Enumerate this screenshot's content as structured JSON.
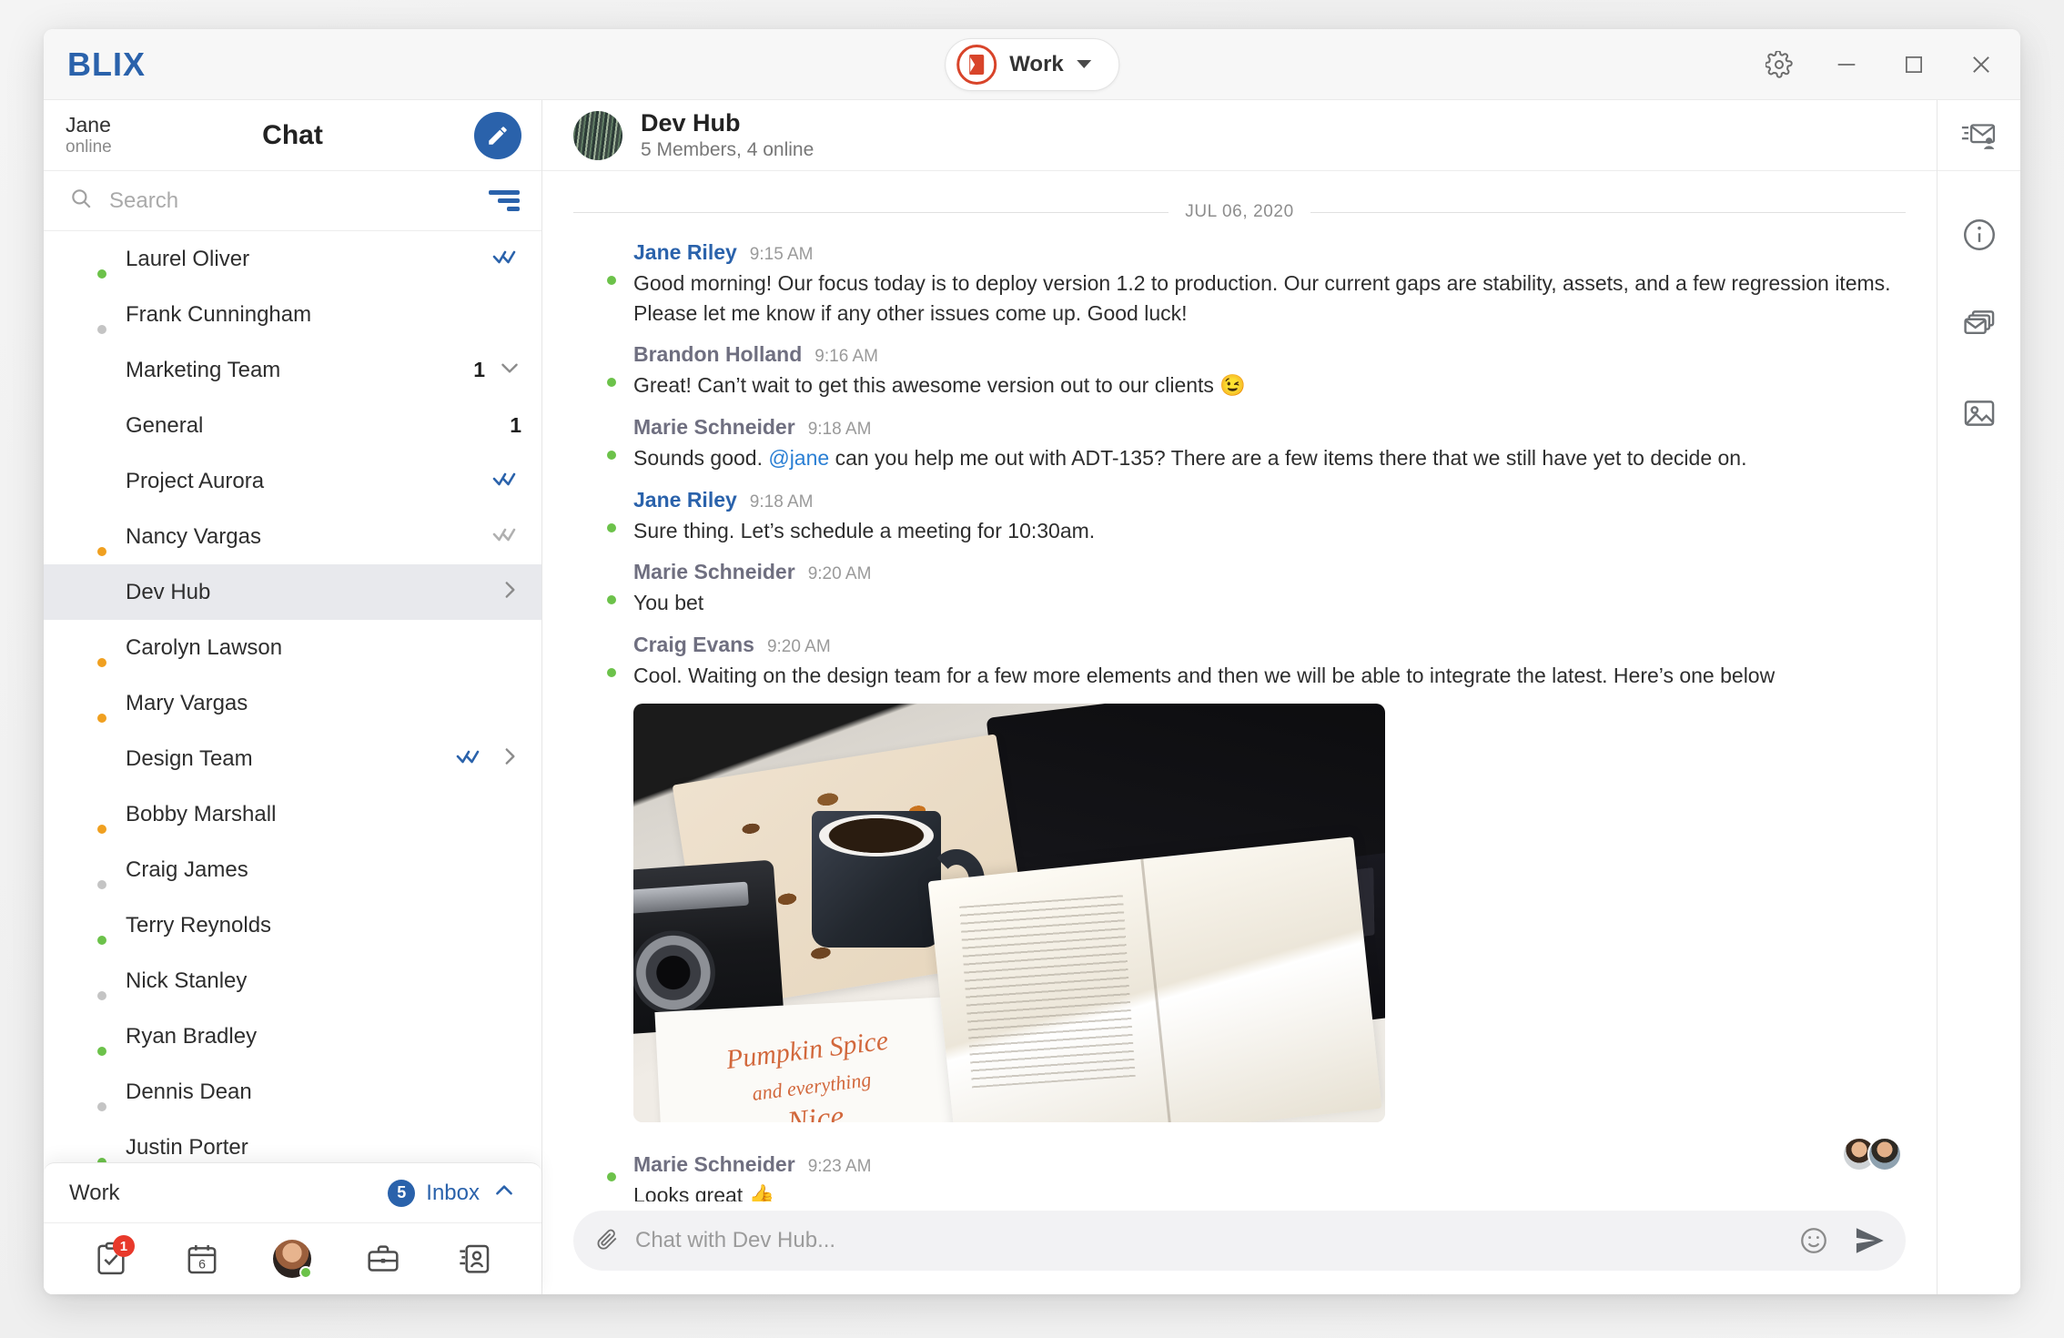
{
  "app": {
    "brand": "BLIX",
    "workspace_label": "Work",
    "office_icon": "office-icon"
  },
  "titlebar": {
    "settings_icon": "gear-icon",
    "minimize_icon": "minimize-icon",
    "maximize_icon": "maximize-icon",
    "close_icon": "close-icon"
  },
  "sidebar": {
    "user_name": "Jane",
    "user_status": "online",
    "title": "Chat",
    "compose_icon": "pencil-icon",
    "search_placeholder": "Search",
    "search_value": "",
    "search_icon": "search-icon",
    "filter_icon": "filter-icon",
    "items": [
      {
        "name": "Laurel Oliver",
        "type": "person",
        "presence": "online",
        "check": "blue",
        "badge": "",
        "chevron": ""
      },
      {
        "name": "Frank Cunningham",
        "type": "person",
        "presence": "offline",
        "check": "",
        "badge": "",
        "chevron": ""
      },
      {
        "name": "Marketing Team",
        "type": "group",
        "presence": "",
        "check": "",
        "badge": "1",
        "chevron": "down"
      },
      {
        "name": "General",
        "type": "sub",
        "presence": "",
        "check": "",
        "badge": "1",
        "chevron": ""
      },
      {
        "name": "Project Aurora",
        "type": "sub",
        "presence": "",
        "check": "blue",
        "badge": "",
        "chevron": ""
      },
      {
        "name": "Nancy Vargas",
        "type": "person",
        "presence": "away",
        "check": "gray",
        "badge": "",
        "chevron": ""
      },
      {
        "name": "Dev Hub",
        "type": "group",
        "presence": "",
        "check": "",
        "badge": "",
        "chevron": "right",
        "active": true
      },
      {
        "name": "Carolyn Lawson",
        "type": "person",
        "presence": "away",
        "check": "",
        "badge": "",
        "chevron": ""
      },
      {
        "name": "Mary Vargas",
        "type": "person",
        "presence": "away",
        "check": "",
        "badge": "",
        "chevron": ""
      },
      {
        "name": "Design Team",
        "type": "group",
        "presence": "",
        "check": "blue",
        "badge": "",
        "chevron": "right"
      },
      {
        "name": "Bobby Marshall",
        "type": "person",
        "presence": "away",
        "check": "",
        "badge": "",
        "chevron": ""
      },
      {
        "name": "Craig James",
        "type": "person",
        "presence": "offline",
        "check": "",
        "badge": "",
        "chevron": ""
      },
      {
        "name": "Terry Reynolds",
        "type": "person",
        "presence": "online",
        "check": "",
        "badge": "",
        "chevron": ""
      },
      {
        "name": "Nick Stanley",
        "type": "person",
        "presence": "offline",
        "check": "",
        "badge": "",
        "chevron": ""
      },
      {
        "name": "Ryan Bradley",
        "type": "person",
        "presence": "online",
        "check": "",
        "badge": "",
        "chevron": ""
      },
      {
        "name": "Dennis Dean",
        "type": "person",
        "presence": "offline",
        "check": "",
        "badge": "",
        "chevron": ""
      },
      {
        "name": "Justin Porter",
        "type": "person",
        "presence": "online",
        "check": "",
        "badge": "",
        "chevron": ""
      }
    ],
    "bottom": {
      "account_label": "Work",
      "inbox_count": "5",
      "inbox_label": "Inbox",
      "collapse_icon": "chevron-up-icon",
      "nav": [
        {
          "icon": "tasks-icon",
          "badge": "1"
        },
        {
          "icon": "calendar-icon",
          "badge": "",
          "day": "6"
        },
        {
          "icon": "avatar-icon",
          "badge": ""
        },
        {
          "icon": "briefcase-icon",
          "badge": ""
        },
        {
          "icon": "contacts-icon",
          "badge": ""
        }
      ]
    }
  },
  "chat": {
    "header": {
      "title": "Dev Hub",
      "subtitle": "5 Members, 4 online"
    },
    "date_separator": "JUL 06, 2020",
    "messages": [
      {
        "author": "Jane Riley",
        "author_color": "blue",
        "time": "9:15 AM",
        "presence": "online",
        "text": "Good morning! Our focus today is to deploy version 1.2 to production. Our current gaps are stability, assets, and a few regression items. Please let me know if any other issues come up. Good luck!",
        "avatar": "jane"
      },
      {
        "author": "Brandon Holland",
        "author_color": "gray",
        "time": "9:16 AM",
        "presence": "online",
        "text": "Great! Can’t wait to get this awesome version out to our clients 😉",
        "avatar": "brandon"
      },
      {
        "author": "Marie Schneider",
        "author_color": "gray",
        "time": "9:18 AM",
        "presence": "online",
        "text_pre": "Sounds good. ",
        "mention": "@jane",
        "text_post": " can you help me out with ADT-135? There are a few items there that we still have yet to decide on.",
        "avatar": "marie"
      },
      {
        "author": "Jane Riley",
        "author_color": "blue",
        "time": "9:18 AM",
        "presence": "online",
        "text": "Sure thing. Let’s schedule a meeting for 10:30am.",
        "avatar": "jane"
      },
      {
        "author": "Marie Schneider",
        "author_color": "gray",
        "time": "9:20 AM",
        "presence": "online",
        "text": "You bet",
        "avatar": "marie"
      },
      {
        "author": "Craig Evans",
        "author_color": "gray",
        "time": "9:20 AM",
        "presence": "online",
        "text": "Cool. Waiting on the design team for a few more elements and then we will be able to integrate the latest. Here’s one below",
        "avatar": "craig",
        "attachment": "photo-coffee-laptop-pumpkin-spice"
      },
      {
        "author": "Marie Schneider",
        "author_color": "gray",
        "time": "9:23 AM",
        "presence": "online",
        "text": "Looks great 👍",
        "avatar": "marie",
        "reactions": [
          "reactor-1",
          "reactor-2"
        ]
      }
    ],
    "photo_text": {
      "line1": "Pumpkin Spice",
      "line2": "and everything",
      "line3": "Nice"
    },
    "composer": {
      "attach_icon": "paperclip-icon",
      "placeholder": "Chat with Dev Hub...",
      "value": "",
      "emoji_icon": "smiley-icon",
      "send_icon": "send-icon"
    }
  },
  "rail": {
    "items": [
      {
        "icon": "group-mail-icon"
      },
      {
        "icon": "info-circle-icon"
      },
      {
        "icon": "stacked-mail-icon"
      },
      {
        "icon": "image-icon"
      }
    ]
  },
  "colors": {
    "brand_blue": "#2a62ab",
    "accent_orange": "#d8442a",
    "online_green": "#6cc24a",
    "away_orange": "#f0a020",
    "offline_gray": "#c4c4c4",
    "unread_red": "#e8392b"
  }
}
